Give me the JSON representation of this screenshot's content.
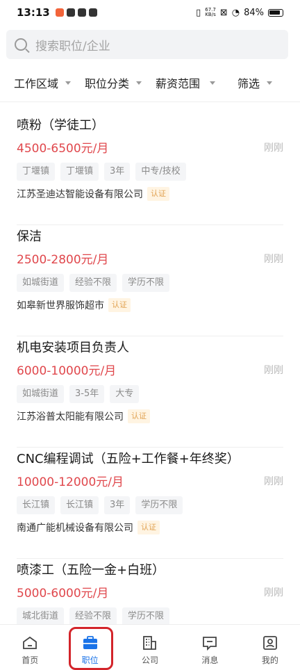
{
  "status_bar": {
    "time": "13:13",
    "net_speed_value": "67.7",
    "net_speed_unit": "KB/s",
    "battery": "84%"
  },
  "search": {
    "placeholder": "搜索职位/企业"
  },
  "filters": [
    "工作区域",
    "职位分类",
    "薪资范围",
    "筛选"
  ],
  "jobs": [
    {
      "title": "喷粉（学徒工）",
      "salary": "4500-6500元/月",
      "time": "刚刚",
      "tags": [
        "丁堰镇",
        "丁堰镇",
        "3年",
        "中专/技校"
      ],
      "company": "江苏圣迪达智能设备有限公司",
      "badge": "认证"
    },
    {
      "title": "保洁",
      "salary": "2500-2800元/月",
      "time": "刚刚",
      "tags": [
        "如城街道",
        "经验不限",
        "学历不限"
      ],
      "company": "如皋新世界服饰超市",
      "badge": "认证"
    },
    {
      "title": "机电安装项目负责人",
      "salary": "6000-10000元/月",
      "time": "刚刚",
      "tags": [
        "如城街道",
        "3-5年",
        "大专"
      ],
      "company": "江苏浴普太阳能有限公司",
      "badge": "认证"
    },
    {
      "title": "CNC编程调试（五险+工作餐+年终奖）",
      "salary": "10000-12000元/月",
      "time": "刚刚",
      "tags": [
        "长江镇",
        "长江镇",
        "3年",
        "学历不限"
      ],
      "company": "南通广能机械设备有限公司",
      "badge": "认证"
    },
    {
      "title": "喷漆工（五险一金+白班）",
      "salary": "5000-6000元/月",
      "time": "刚刚",
      "tags": [
        "城北街道",
        "经验不限",
        "学历不限"
      ],
      "company": "",
      "badge": ""
    }
  ],
  "tabbar": [
    {
      "label": "首页",
      "icon": "home-icon",
      "active": false
    },
    {
      "label": "职位",
      "icon": "briefcase-icon",
      "active": true
    },
    {
      "label": "公司",
      "icon": "building-icon",
      "active": false
    },
    {
      "label": "消息",
      "icon": "message-icon",
      "active": false
    },
    {
      "label": "我的",
      "icon": "profile-icon",
      "active": false
    }
  ],
  "colors": {
    "salary": "#e0474c",
    "active_tab": "#1a73e8",
    "highlight": "#d3242a"
  }
}
